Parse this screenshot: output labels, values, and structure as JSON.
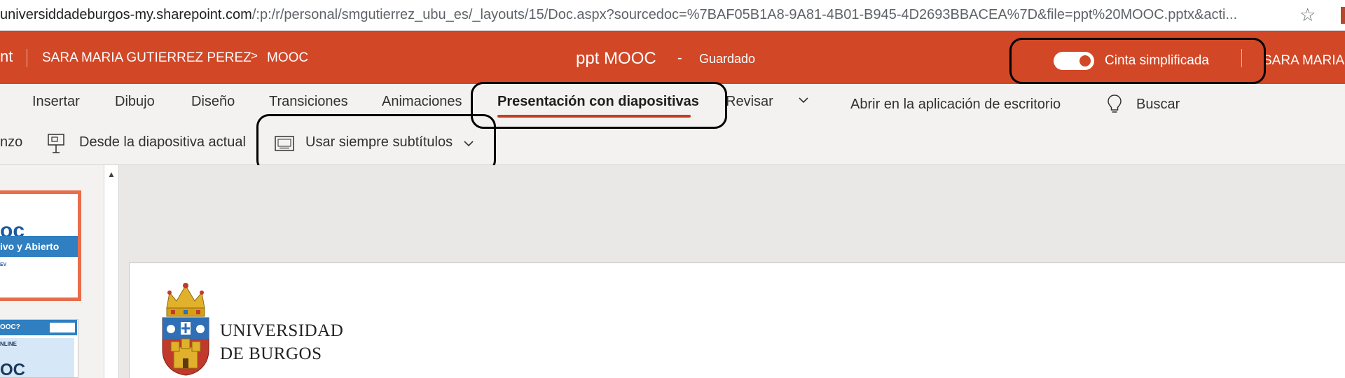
{
  "browser": {
    "url_host": "universiddadeburgos-my.sharepoint.com",
    "url_path": "/:p:/r/personal/smgutierrez_ubu_es/_layouts/15/Doc.aspx?sourcedoc=%7BAF05B1A8-9A81-4B01-B945-4D2693BBACEA%7D&file=ppt%20MOOC.pptx&acti...",
    "star_icon": "star-icon"
  },
  "header": {
    "app_suffix": "nt",
    "user_name": "SARA MARIA GUTIERREZ PEREZ",
    "breadcrumb_chevron": ">",
    "folder_name": "MOOC",
    "doc_title": "ppt MOOC",
    "title_separator": "-",
    "save_status": "Guardado",
    "simplified_ribbon_label": "Cinta simplificada",
    "simplified_ribbon_on": true,
    "user_name_right": "SARA MARIA",
    "brand_color": "#d24726"
  },
  "ribbon": {
    "tabs": [
      {
        "label": "Insertar"
      },
      {
        "label": "Dibujo"
      },
      {
        "label": "Diseño"
      },
      {
        "label": "Transiciones"
      },
      {
        "label": "Animaciones"
      },
      {
        "label": "Presentación con diapositivas",
        "active": true
      },
      {
        "label": "Revisar"
      }
    ],
    "more_tabs_icon": "chevron-down-icon",
    "open_desktop_label": "Abrir en la aplicación de escritorio",
    "search_label": "Buscar",
    "commands": {
      "from_beginning_partial": "nzo",
      "from_current_label": "Desde la diapositiva actual",
      "subtitles_label": "Usar siempre subtítulos"
    }
  },
  "thumbnails": [
    {
      "title_partial": "oc",
      "band_text": "ivo y Abierto",
      "small_text": "EV"
    },
    {
      "title_partial": "OOC?",
      "online_text": "NLINE",
      "big_text": "OC"
    }
  ],
  "slide": {
    "university_line1": "UNIVERSIDAD",
    "university_line2": "DE BURGOS"
  }
}
